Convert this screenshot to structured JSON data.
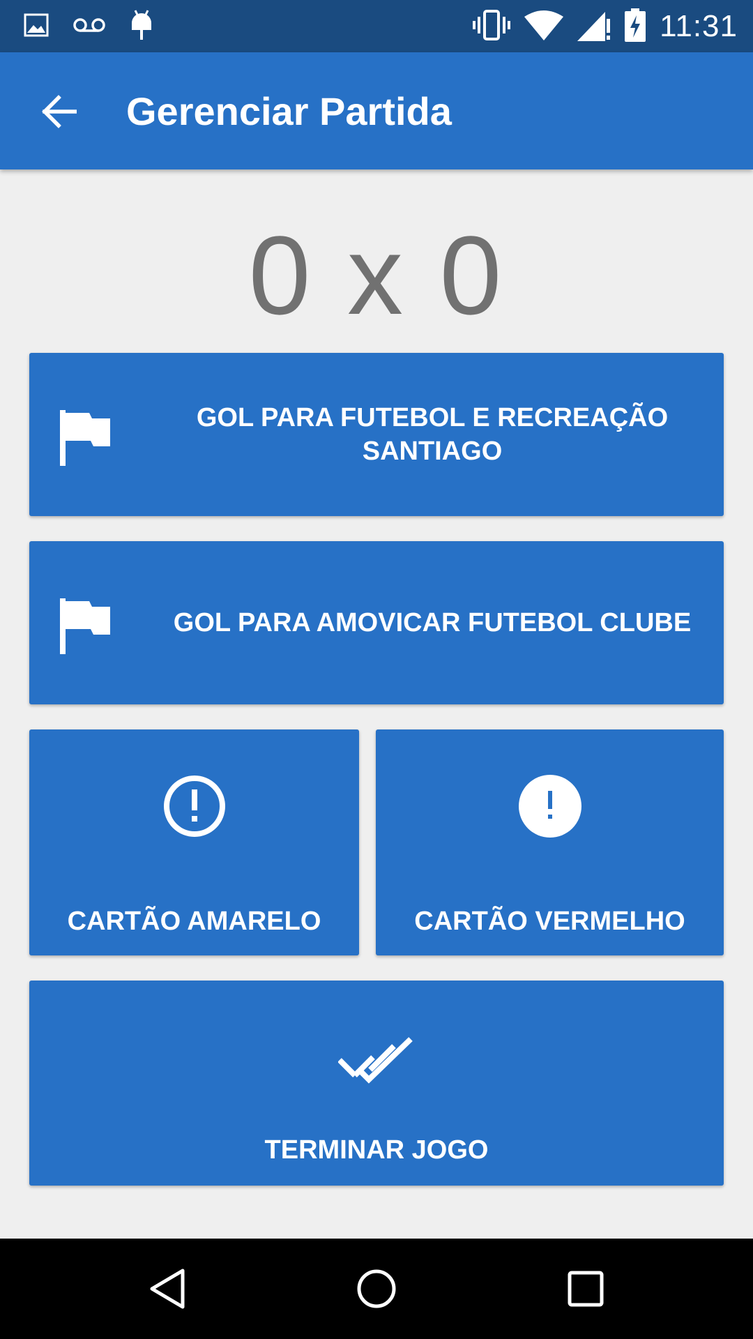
{
  "status_bar": {
    "time": "11:31",
    "left_icons": [
      "image-icon",
      "voicemail-icon",
      "android-debug-icon"
    ],
    "right_icons": [
      "vibrate-icon",
      "wifi-icon",
      "signal-icon",
      "battery-charging-icon"
    ]
  },
  "app_bar": {
    "title": "Gerenciar Partida",
    "back_icon": "arrow-back-icon"
  },
  "score": {
    "home": "0",
    "separator": "x",
    "away": "0"
  },
  "actions": {
    "goal_home": {
      "label": "GOL PARA FUTEBOL E RECREAÇÃO SANTIAGO",
      "icon": "flag-icon"
    },
    "goal_away": {
      "label": "GOL PARA AMOVICAR FUTEBOL CLUBE",
      "icon": "flag-icon"
    },
    "yellow_card": {
      "label": "CARTÃO AMARELO",
      "icon": "error-outline-icon"
    },
    "red_card": {
      "label": "CARTÃO VERMELHO",
      "icon": "error-filled-icon"
    },
    "end_game": {
      "label": "TERMINAR JOGO",
      "icon": "done-all-icon"
    }
  },
  "nav_bar": {
    "back": "nav-back-icon",
    "home": "nav-home-icon",
    "recents": "nav-recents-icon"
  },
  "colors": {
    "status_bar": "#1a4b80",
    "primary": "#2771c6",
    "background": "#efefef",
    "score_text": "#717171"
  }
}
